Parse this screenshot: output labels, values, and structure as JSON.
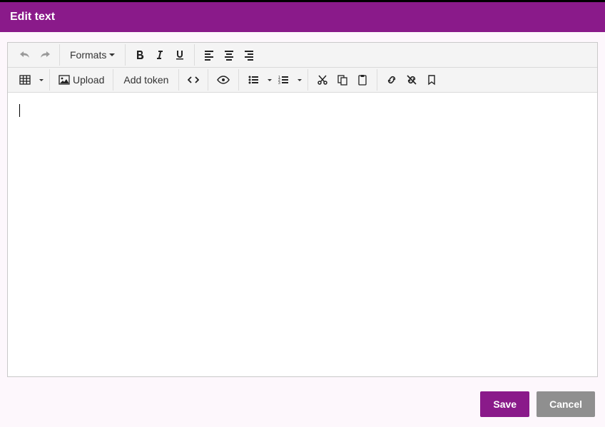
{
  "header": {
    "title": "Edit text"
  },
  "toolbar": {
    "formats_label": "Formats",
    "upload_label": "Upload",
    "add_token_label": "Add token"
  },
  "buttons": {
    "save": "Save",
    "cancel": "Cancel"
  },
  "editor": {
    "content": ""
  }
}
